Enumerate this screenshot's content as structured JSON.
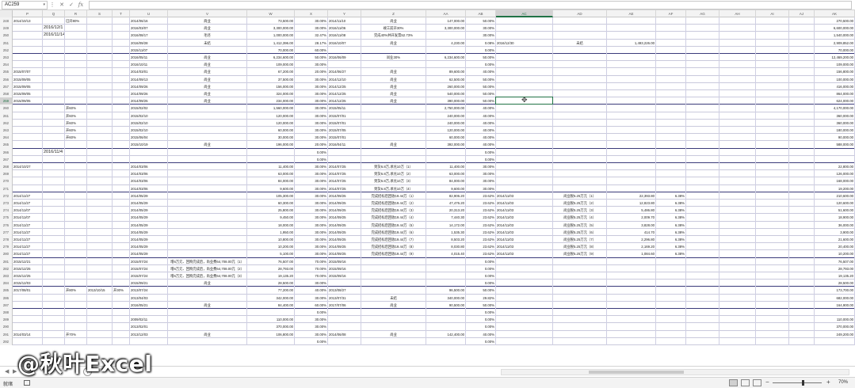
{
  "name_box": "AC259",
  "formula": {
    "cancel": "✕",
    "enter": "✓",
    "fx": "fx",
    "value": ""
  },
  "columns": [
    "P",
    "Q",
    "R",
    "S",
    "T",
    "U",
    "V",
    "W",
    "X",
    "Y",
    "Z",
    "AA",
    "AB",
    "AC",
    "AD",
    "AE",
    "AF",
    "AG",
    "AH",
    "AI",
    "AJ",
    "AK"
  ],
  "selected_column": "AC",
  "selected_row": "259",
  "rows": [
    {
      "n": "248",
      "P": "2014/10/13",
      "R": "已开80%",
      "U": "2014/06/16",
      "V": "商业",
      "W": "73,500.00",
      "X": "30.00%",
      "Y": "2014/11/10",
      "Z": "尚业",
      "AA": "147,000.00",
      "AB": "50.00%",
      "AK": "270,500.00"
    },
    {
      "n": "249",
      "Q": "2016/12/1",
      "U": "2016/03/07",
      "V": "尚业",
      "W": "3,300,000.00",
      "X": "30.00%",
      "Y": "2016/11/06",
      "Z": "竣工前开30%",
      "AA": "3,300,000.00",
      "AB": "30.00%",
      "AK": "6,600,000.00"
    },
    {
      "n": "250",
      "Q": "2016/11/14",
      "U": "2016/08/17",
      "V": "毛坯",
      "W": "1,000,000.00",
      "X": "32.47%",
      "Y": "2016/11/08",
      "Z": "完成40%并开发票52.73%",
      "AA": "",
      "AB": "30.00%",
      "AK": "1,540,000.00"
    },
    {
      "n": "251",
      "U": "2016/09/28",
      "V": "未结",
      "W": "1,412,396.00",
      "X": "28.17%",
      "Y": "2016/10/07",
      "Z": "尚业",
      "AA": "4,230.00",
      "AB": "0.08%",
      "AC": "2016/12/30",
      "AD": "未结",
      "AE": "1,493,226.00",
      "AK": "2,909,852.00"
    },
    {
      "n": "252",
      "U": "2015/11/07",
      "W": "70,000.00",
      "X": "60.00%",
      "AB": "0.00%",
      "AK": "70,000.00"
    },
    {
      "n": "253",
      "U": "2016/05/11",
      "V": "尚业",
      "W": "6,234,600.00",
      "X": "50.00%",
      "Y": "2016/06/09",
      "Z": "尚业30%",
      "AA": "6,234,600.00",
      "AB": "50.00%",
      "AK": "12,469,200.00"
    },
    {
      "n": "254",
      "U": "2016/10/11",
      "V": "尚业",
      "W": "109,000.00",
      "X": "30.00%",
      "AB": "0.00%",
      "AK": "109,000.00"
    },
    {
      "n": "255",
      "P": "2015/07/07",
      "U": "2014/03/01",
      "V": "尚业",
      "W": "67,200.00",
      "X": "20.00%",
      "Y": "2014/06/27",
      "Z": "尚业",
      "AA": "89,600.00",
      "AB": "40.00%",
      "AK": "156,800.00"
    },
    {
      "n": "256",
      "P": "2015/09/05",
      "U": "2014/09/13",
      "V": "尚业",
      "W": "37,500.00",
      "X": "30.00%",
      "Y": "2014/12/10",
      "Z": "尚业",
      "AA": "62,500.00",
      "AB": "50.00%",
      "AK": "100,000.00"
    },
    {
      "n": "257",
      "P": "2015/09/05",
      "U": "2014/09/26",
      "V": "尚业",
      "W": "156,000.00",
      "X": "30.00%",
      "Y": "2014/12/25",
      "Z": "尚业",
      "AA": "260,000.00",
      "AB": "50.00%",
      "AK": "416,000.00"
    },
    {
      "n": "258",
      "P": "2015/09/05",
      "U": "2014/09/26",
      "V": "尚业",
      "W": "324,000.00",
      "X": "30.00%",
      "Y": "2014/12/25",
      "Z": "尚业",
      "AA": "540,000.00",
      "AB": "50.00%",
      "AK": "864,000.00"
    },
    {
      "n": "259",
      "P": "2015/09/05",
      "U": "2014/09/25",
      "V": "尚业",
      "W": "234,000.00",
      "X": "30.00%",
      "Y": "2014/12/25",
      "Z": "尚业",
      "AA": "390,000.00",
      "AB": "50.00%",
      "AK": "624,000.00"
    },
    {
      "n": "260",
      "R": "开60%",
      "U": "2015/02/02",
      "W": "1,560,000.00",
      "X": "30.00%",
      "Y": "2015/05/11",
      "AA": "2,750,000.00",
      "AB": "40.00%",
      "AK": "4,170,000.00"
    },
    {
      "n": "261",
      "R": "开60%",
      "U": "2015/02/10",
      "W": "120,000.00",
      "X": "30.00%",
      "Y": "2015/07/01",
      "AA": "240,000.00",
      "AB": "40.00%",
      "AK": "360,000.00"
    },
    {
      "n": "262",
      "R": "开60%",
      "U": "2015/02/10",
      "W": "120,000.00",
      "X": "30.00%",
      "Y": "2015/07/01",
      "AA": "240,000.00",
      "AB": "40.00%",
      "AK": "360,000.00"
    },
    {
      "n": "263",
      "R": "开60%",
      "U": "2015/02/10",
      "W": "60,000.00",
      "X": "30.00%",
      "Y": "2015/07/05",
      "AA": "120,000.00",
      "AB": "40.00%",
      "AK": "180,000.00"
    },
    {
      "n": "264",
      "R": "开60%",
      "U": "2015/06/04",
      "W": "30,000.00",
      "X": "30.00%",
      "Y": "2015/07/01",
      "AA": "60,000.00",
      "AB": "40.00%",
      "AK": "90,000.00"
    },
    {
      "n": "265",
      "U": "2015/10/19",
      "V": "尚业",
      "W": "196,000.00",
      "X": "20.00%",
      "Y": "2016/04/11",
      "Z": "尚业",
      "AA": "392,000.00",
      "AB": "40.00%",
      "AK": "588,000.00"
    },
    {
      "n": "266",
      "Q": "2016/11/4",
      "X": "0.00%",
      "AB": "0.00%",
      "AK": ""
    },
    {
      "n": "267",
      "X": "0.00%",
      "AB": "0.00%"
    },
    {
      "n": "268",
      "P": "2014/10/27",
      "U": "2014/03/06",
      "W": "11,400.00",
      "X": "30.00%",
      "Y": "2014/07/25",
      "Z": "到货6.8万,承兑10万（1）",
      "AA": "11,400.00",
      "AB": "30.00%",
      "AK": "22,800.00"
    },
    {
      "n": "269",
      "U": "2014/03/06",
      "W": "63,000.00",
      "X": "30.00%",
      "Y": "2014/07/25",
      "Z": "到货6.8万,承兑10万（2）",
      "AA": "63,000.00",
      "AB": "30.00%",
      "AK": "126,000.00"
    },
    {
      "n": "270",
      "U": "2014/03/06",
      "W": "84,000.00",
      "X": "30.00%",
      "Y": "2014/07/25",
      "Z": "到货6.8万,承兑10万（3）",
      "AA": "84,000.00",
      "AB": "30.00%",
      "AK": "168,000.00"
    },
    {
      "n": "271",
      "U": "2014/03/06",
      "W": "9,600.00",
      "X": "30.00%",
      "Y": "2014/07/25",
      "Z": "到货6.8万,承兑10万（4）",
      "AA": "9,600.00",
      "AB": "30.00%",
      "AK": "19,200.00"
    },
    {
      "n": "272",
      "P": "2014/11/27",
      "U": "2014/05/29",
      "W": "105,300.00",
      "X": "30.00%",
      "Y": "2014/09/25",
      "Z": "完成招标后回收19.44万（1）",
      "AA": "82,906.20",
      "AB": "23.62%",
      "AC": "2014/11/03",
      "AD": "尚业税5.25万元（1）",
      "AE": "22,393.80",
      "AF": "6.38%",
      "AK": "210,600.00"
    },
    {
      "n": "273",
      "P": "2014/11/27",
      "U": "2014/05/29",
      "W": "60,300.00",
      "X": "30.00%",
      "Y": "2014/09/25",
      "Z": "完成招标后回收19.44万（2）",
      "AA": "47,476.20",
      "AB": "23.62%",
      "AC": "2014/11/03",
      "AD": "尚业税5.25万元（2）",
      "AE": "12,823.80",
      "AF": "6.38%",
      "AK": "120,600.00"
    },
    {
      "n": "274",
      "P": "2014/11/07",
      "U": "2014/05/29",
      "W": "25,800.00",
      "X": "30.00%",
      "Y": "2014/09/25",
      "Z": "完成招标后回收19.44万（3）",
      "AA": "20,313.20",
      "AB": "23.62%",
      "AC": "2014/11/03",
      "AD": "尚业税5.25万元（3）",
      "AE": "5,486.80",
      "AF": "6.38%",
      "AK": "51,600.00"
    },
    {
      "n": "275",
      "P": "2014/11/07",
      "U": "2014/05/29",
      "W": "9,450.00",
      "X": "30.00%",
      "Y": "2014/09/25",
      "Z": "完成招标后回收19.44万（4）",
      "AA": "7,440.30",
      "AB": "23.62%",
      "AC": "2014/11/03",
      "AD": "尚业税5.25万元（4）",
      "AE": "2,009.70",
      "AF": "6.38%",
      "AK": "18,900.00"
    },
    {
      "n": "276",
      "P": "2014/11/27",
      "U": "2014/05/29",
      "W": "18,000.00",
      "X": "30.00%",
      "Y": "2014/09/25",
      "Z": "完成招标后回收19.44万（5）",
      "AA": "14,172.00",
      "AB": "23.62%",
      "AC": "2014/11/03",
      "AD": "尚业税5.25万元（5）",
      "AE": "3,828.00",
      "AF": "6.38%",
      "AK": "36,000.00"
    },
    {
      "n": "277",
      "P": "2014/11/27",
      "U": "2014/05/29",
      "W": "1,950.00",
      "X": "30.00%",
      "Y": "2014/09/25",
      "Z": "完成招标后回收19.44万（6）",
      "AA": "1,535.30",
      "AB": "23.62%",
      "AC": "2014/11/03",
      "AD": "尚业税5.25万元（6）",
      "AE": "414.70",
      "AF": "6.38%",
      "AK": "3,900.00"
    },
    {
      "n": "278",
      "P": "2014/11/27",
      "U": "2014/05/29",
      "W": "10,800.00",
      "X": "30.00%",
      "Y": "2014/09/25",
      "Z": "完成招标后回收19.44万（7）",
      "AA": "8,503.20",
      "AB": "23.62%",
      "AC": "2014/11/03",
      "AD": "尚业税5.25万元（7）",
      "AE": "2,296.80",
      "AF": "6.38%",
      "AK": "21,600.00"
    },
    {
      "n": "279",
      "P": "2014/11/27",
      "U": "2014/05/29",
      "W": "10,200.00",
      "X": "30.00%",
      "Y": "2014/09/25",
      "Z": "完成招标后回收19.44万（8）",
      "AA": "8,030.80",
      "AB": "23.62%",
      "AC": "2014/11/03",
      "AD": "尚业税5.25万元（8）",
      "AE": "2,169.20",
      "AF": "6.38%",
      "AK": "20,400.00"
    },
    {
      "n": "280",
      "P": "2014/11/27",
      "U": "2014/05/29",
      "W": "5,100.00",
      "X": "30.00%",
      "Y": "2014/09/25",
      "Z": "完成招标后回收19.44万（9）",
      "AA": "4,015.40",
      "AB": "23.62%",
      "AC": "2014/11/03",
      "AD": "尚业税5.25万元（9）",
      "AE": "1,084.60",
      "AF": "6.38%",
      "AK": "10,200.00"
    },
    {
      "n": "281",
      "P": "2015/12/21",
      "U": "2015/07/24",
      "V": "增6万元、回购完成后，尚业费64,708.00元（1）",
      "W": "76,507.00",
      "X": "70.00%",
      "Y": "2015/09/16",
      "AB": "0.00%",
      "AK": "76,507.00"
    },
    {
      "n": "282",
      "P": "2015/12/25",
      "U": "2015/07/24",
      "V": "增6万元、回购完成后，尚业费64,708.00元（2）",
      "W": "28,793.00",
      "X": "70.00%",
      "Y": "2015/09/16",
      "AB": "0.00%",
      "AK": "28,793.00"
    },
    {
      "n": "283",
      "P": "2015/12/25",
      "U": "2015/07/24",
      "V": "增6万元、回购完成后，尚业费64,708.00元（3）",
      "W": "19,135.20",
      "X": "70.00%",
      "Y": "2015/09/16",
      "AB": "0.00%",
      "AK": "19,135.20"
    },
    {
      "n": "284",
      "P": "2015/12/03",
      "U": "2015/09/21",
      "V": "尚业",
      "W": "28,500.00",
      "X": "30.00%",
      "AB": "0.00%",
      "AK": "28,500.00"
    },
    {
      "n": "285",
      "P": "2017/08/01",
      "R": "开80%",
      "S": "2013/10/15",
      "T": "开30%",
      "U": "2013/07/24",
      "W": "77,200.00",
      "X": "40.00%",
      "Y": "2013/08/27",
      "AA": "96,500.00",
      "AB": "50.00%",
      "AK": "173,700.00"
    },
    {
      "n": "286",
      "U": "2013/04/03",
      "W": "342,000.00",
      "X": "30.00%",
      "Y": "2013/07/31",
      "Z": "未结",
      "AA": "340,000.00",
      "AB": "29.82%",
      "AK": "682,000.00"
    },
    {
      "n": "287",
      "U": "2016/05/21",
      "V": "尚业",
      "W": "84,400.00",
      "X": "60.00%",
      "Y": "2017/07/06",
      "Z": "尚业",
      "AA": "90,500.00",
      "AB": "50.00%",
      "AK": "164,900.00"
    },
    {
      "n": "288",
      "X": "0.00%",
      "AB": "0.00%"
    },
    {
      "n": "289",
      "U": "2009/02/11",
      "W": "110,000.00",
      "X": "30.00%",
      "AB": "0.00%",
      "AK": "110,000.00"
    },
    {
      "n": "290",
      "U": "2013/02/01",
      "W": "370,000.00",
      "X": "30.00%",
      "AB": "0.00%",
      "AK": "370,000.00"
    },
    {
      "n": "291",
      "P": "2014/03/14",
      "R": "开70%",
      "U": "2013/12/03",
      "V": "尚业",
      "W": "106,800.00",
      "X": "30.00%",
      "Y": "2014/06/08",
      "Z": "尚业",
      "AA": "142,400.00",
      "AB": "40.00%",
      "AK": "249,200.00"
    },
    {
      "n": "292",
      "X": "0.00%",
      "AB": "0.00%"
    }
  ],
  "sheet_tabs_add": "+",
  "status": {
    "ready": "就绪",
    "zoom": "70%",
    "zoom_minus": "−",
    "zoom_plus": "+"
  },
  "watermark": "@秋叶Excel"
}
